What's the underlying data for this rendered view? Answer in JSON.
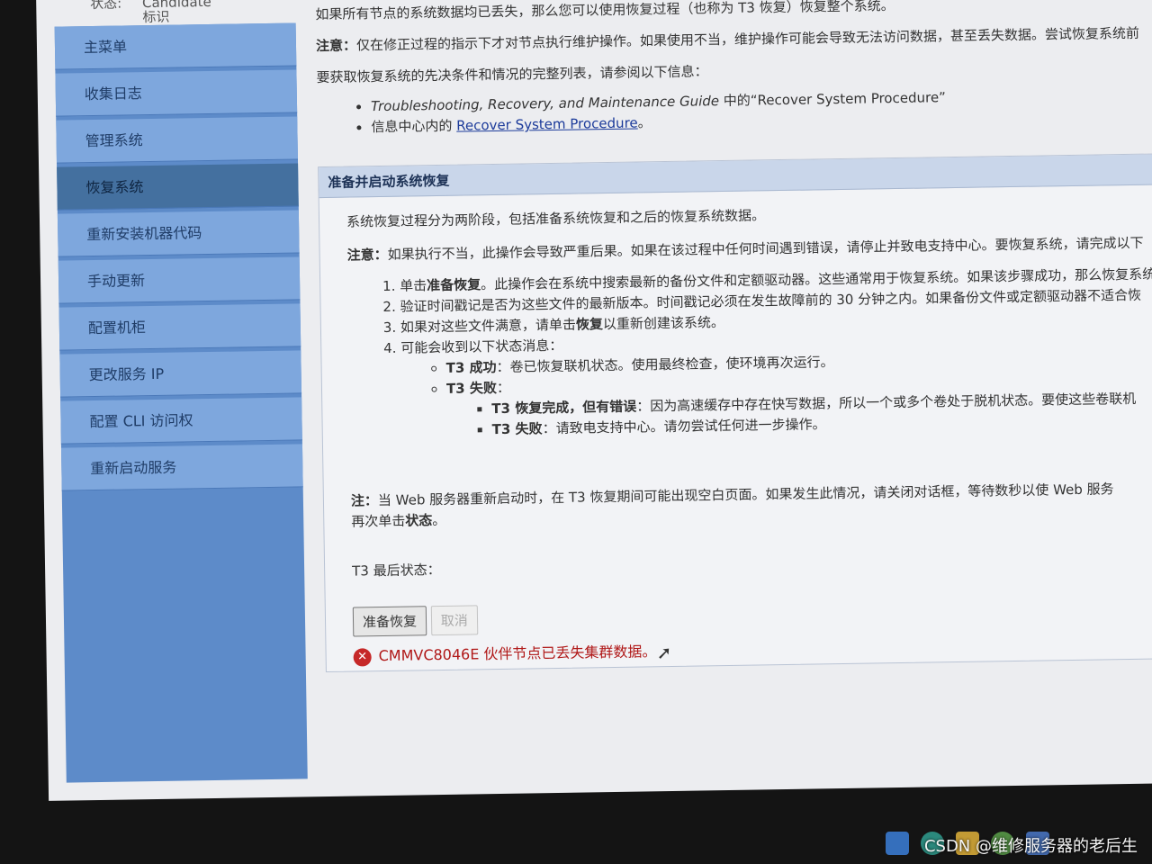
{
  "status": {
    "label": "状态:",
    "value": "Candidate",
    "id_label": "标识"
  },
  "sidebar": {
    "items": [
      {
        "label": "主菜单"
      },
      {
        "label": "收集日志"
      },
      {
        "label": "管理系统"
      },
      {
        "label": "恢复系统",
        "active": true
      },
      {
        "label": "重新安装机器代码"
      },
      {
        "label": "手动更新"
      },
      {
        "label": "配置机柜"
      },
      {
        "label": "更改服务 IP"
      },
      {
        "label": "配置 CLI 访问权"
      },
      {
        "label": "重新启动服务"
      }
    ]
  },
  "intro": {
    "line1": "如果所有节点的系统数据均已丢失，那么您可以使用恢复过程（也称为 T3 恢复）恢复整个系统。",
    "note_label": "注意：",
    "note_text": "仅在修正过程的指示下才对节点执行维护操作。如果使用不当，维护操作可能会导致无法访问数据，甚至丢失数据。尝试恢复系统前",
    "prereq": "要获取恢复系统的先决条件和情况的完整列表，请参阅以下信息：",
    "link1_italic": "Troubleshooting, Recovery, and Maintenance Guide",
    "link1_suffix": " 中的“Recover System Procedure”",
    "link2_prefix": "信息中心内的 ",
    "link2_text": "Recover System Procedure",
    "link2_end": "。"
  },
  "panel": {
    "title": "准备并启动系统恢复",
    "desc": "系统恢复过程分为两阶段，包括准备系统恢复和之后的恢复系统数据。",
    "note_label": "注意：",
    "note_text": "如果执行不当，此操作会导致严重后果。如果在该过程中任何时间遇到错误，请停止并致电支持中心。要恢复系统，请完成以下",
    "step1_pre": "单击",
    "step1_bold": "准备恢复",
    "step1_post": "。此操作会在系统中搜索最新的备份文件和定额驱动器。这些通常用于恢复系统。如果该步骤成功，那么恢复系统",
    "step2": "验证时间戳记是否为这些文件的最新版本。时间戳记必须在发生故障前的 30 分钟之内。如果备份文件或定额驱动器不适合恢",
    "step3_pre": "如果对这些文件满意，请单击",
    "step3_bold": "恢复",
    "step3_post": "以重新创建该系统。",
    "step4": "可能会收到以下状态消息：",
    "success_bold": "T3 成功",
    "success_text": "：卷已恢复联机状态。使用最终检查，使环境再次运行。",
    "fail_bold": "T3 失败",
    "fail_colon": "：",
    "fail_sub1_bold": "T3 恢复完成，但有错误",
    "fail_sub1_text": "：因为高速缓存中存在快写数据，所以一个或多个卷处于脱机状态。要使这些卷联机",
    "fail_sub2_bold": "T3 失败",
    "fail_sub2_text": "：请致电支持中心。请勿尝试任何进一步操作。",
    "web_note_label": "注：",
    "web_note_text": "当 Web 服务器重新启动时，在 T3 恢复期间可能出现空白页面。如果发生此情况，请关闭对话框，等待数秒以使 Web 服务",
    "web_note_line2_pre": "再次单击",
    "web_note_line2_bold": "状态",
    "web_note_line2_post": "。",
    "last_status_label": "T3 最后状态：",
    "prepare_button": "准备恢复",
    "cancel_button": "取消",
    "error_message": "CMMVC8046E 伙伴节点已丢失集群数据。"
  },
  "watermark": "CSDN @维修服务器的老后生",
  "colors": {
    "sidebar": "#5d8bc9",
    "nav_item": "#7ea7dd",
    "nav_active": "#44709f",
    "panel_header": "#c9d6ea",
    "error": "#b01818"
  }
}
